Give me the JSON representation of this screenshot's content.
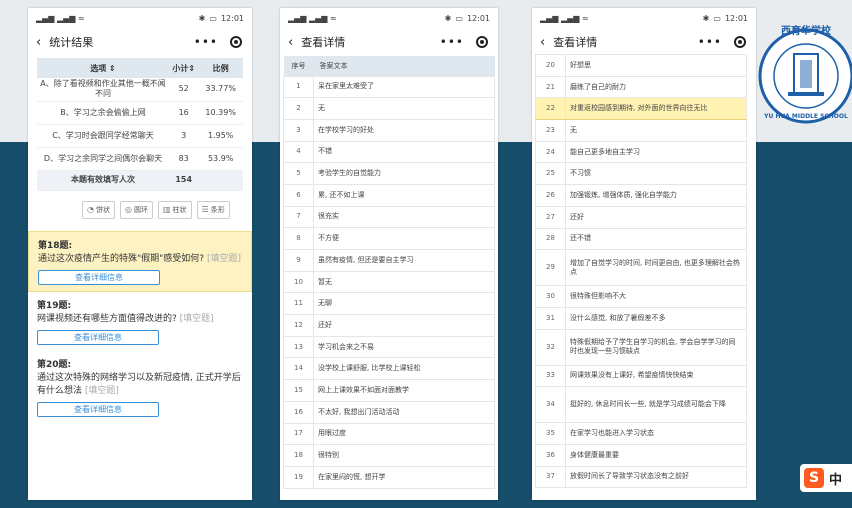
{
  "status_time": "12:01",
  "screen1": {
    "title": "统计结果",
    "headers": [
      "选项 ⇕",
      "小计⇕",
      "比例"
    ],
    "rows": [
      {
        "option": "A、除了看视频和作业其他一概不闻不问",
        "count": "52",
        "ratio": "33.77%"
      },
      {
        "option": "B、学习之余会偷偷上网",
        "count": "16",
        "ratio": "10.39%"
      },
      {
        "option": "C、学习时会跟同学经常聊天",
        "count": "3",
        "ratio": "1.95%"
      },
      {
        "option": "D、学习之余同学之间偶尔会聊天",
        "count": "83",
        "ratio": "53.9%"
      }
    ],
    "total_label": "本题有效填写人次",
    "total_value": "154",
    "chart_buttons": [
      "饼状",
      "圆环",
      "柱状",
      "条形"
    ],
    "questions": [
      {
        "title": "第18题:",
        "text": "通过这次疫情产生的特殊\"假期\"感受如何?",
        "tag": "[填空题]",
        "button": "查看详细信息"
      },
      {
        "title": "第19题:",
        "text": "网课视频还有哪些方面值得改进的?",
        "tag": "[填空题]",
        "button": "查看详细信息"
      },
      {
        "title": "第20题:",
        "text": "通过这次特殊的网络学习以及新冠疫情, 正式开学后有什么想法",
        "tag": "[填空题]",
        "button": "查看详细信息"
      }
    ]
  },
  "screen2": {
    "title": "查看详情",
    "headers": [
      "序号",
      "答案文本"
    ],
    "rows": [
      {
        "n": "1",
        "t": "呆在家里太难受了"
      },
      {
        "n": "2",
        "t": "无"
      },
      {
        "n": "3",
        "t": "在学校学习的好处"
      },
      {
        "n": "4",
        "t": "不错"
      },
      {
        "n": "5",
        "t": "考验学生的自觉能力"
      },
      {
        "n": "6",
        "t": "累, 还不如上课"
      },
      {
        "n": "7",
        "t": "很充实"
      },
      {
        "n": "8",
        "t": "不方便"
      },
      {
        "n": "9",
        "t": "虽然有疫情, 但还是要自主学习"
      },
      {
        "n": "10",
        "t": "暂无"
      },
      {
        "n": "11",
        "t": "无聊"
      },
      {
        "n": "12",
        "t": "还好"
      },
      {
        "n": "13",
        "t": "学习机会来之不易"
      },
      {
        "n": "14",
        "t": "没学校上课舒服, 比学校上课轻松"
      },
      {
        "n": "15",
        "t": "网上上课效果不如面对面教学"
      },
      {
        "n": "16",
        "t": "不太好, 我想出门活动活动"
      },
      {
        "n": "17",
        "t": "用眼过度"
      },
      {
        "n": "18",
        "t": "很特别"
      },
      {
        "n": "19",
        "t": "在家里闷的慌, 想开学"
      }
    ]
  },
  "screen3": {
    "title": "查看详情",
    "rows": [
      {
        "n": "20",
        "t": "好想思"
      },
      {
        "n": "21",
        "t": "磨练了自己的耐力"
      },
      {
        "n": "22",
        "t": "对重返校园感到期待, 对外面的世界向往无比"
      },
      {
        "n": "23",
        "t": "无"
      },
      {
        "n": "24",
        "t": "能自己更多地自主学习"
      },
      {
        "n": "25",
        "t": "不习惯"
      },
      {
        "n": "26",
        "t": "加强锻炼, 增强体质, 强化自学能力"
      },
      {
        "n": "27",
        "t": "还好"
      },
      {
        "n": "28",
        "t": "还不错"
      },
      {
        "n": "29",
        "t": "增加了自觉学习的时间, 时间更自由, 也更多理解社会热点"
      },
      {
        "n": "30",
        "t": "很特殊但影响不大"
      },
      {
        "n": "31",
        "t": "没什么感觉, 和放了暑假差不多"
      },
      {
        "n": "32",
        "t": "特殊假期给予了学生自学习的机会, 学会自学学习的同时也发现一些习惯缺点"
      },
      {
        "n": "33",
        "t": "网课效果没有上课好, 希望疫情快快结束"
      },
      {
        "n": "34",
        "t": "挺好的, 休息时间长一些, 就是学习成绩可能会下降"
      },
      {
        "n": "35",
        "t": "在家学习也能进入学习状态"
      },
      {
        "n": "36",
        "t": "身体健康最重要"
      },
      {
        "n": "37",
        "t": "放假时间长了导致学习状态没有之前好"
      }
    ]
  },
  "logo": {
    "arc_text": "西育华学校",
    "ring_text": "YU HUA MIDDLE SCHOOL"
  },
  "ime": {
    "label": "中"
  },
  "colors": {
    "accent": "#3a8fd8",
    "band": "#174e6b",
    "highlight": "#fdf2c2"
  }
}
